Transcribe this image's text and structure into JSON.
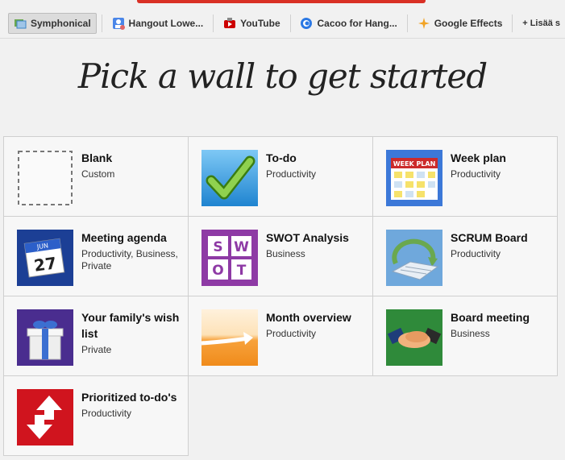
{
  "toolbar": {
    "items": [
      {
        "label": "Symphonical",
        "icon": "symphonical-icon"
      },
      {
        "label": "Hangout Lowe...",
        "icon": "hangout-icon"
      },
      {
        "label": "YouTube",
        "icon": "youtube-icon"
      },
      {
        "label": "Cacoo for Hang...",
        "icon": "cacoo-icon"
      },
      {
        "label": "Google Effects",
        "icon": "sparkle-icon"
      }
    ],
    "more_label": "+ Lisää s"
  },
  "page_title": "Pick a wall to get started",
  "walls": [
    {
      "name": "Blank",
      "category": "Custom",
      "icon": "blank-wall-icon"
    },
    {
      "name": "To-do",
      "category": "Productivity",
      "icon": "checkmark-icon"
    },
    {
      "name": "Week plan",
      "category": "Productivity",
      "icon": "calendar-icon",
      "badge": "WEEK PLAN"
    },
    {
      "name": "Meeting agenda",
      "category": "Productivity, Business, Private",
      "icon": "date-calendar-icon",
      "month": "JUN",
      "day": "27"
    },
    {
      "name": "SWOT Analysis",
      "category": "Business",
      "icon": "swot-icon",
      "letters": [
        "S",
        "W",
        "O",
        "T"
      ]
    },
    {
      "name": "SCRUM Board",
      "category": "Productivity",
      "icon": "scrum-board-icon"
    },
    {
      "name": "Your family's wish list",
      "category": "Private",
      "icon": "gift-icon"
    },
    {
      "name": "Month overview",
      "category": "Productivity",
      "icon": "arrow-right-icon"
    },
    {
      "name": "Board meeting",
      "category": "Business",
      "icon": "handshake-icon"
    },
    {
      "name": "Prioritized to-do's",
      "category": "Productivity",
      "icon": "up-down-arrows-icon"
    }
  ]
}
